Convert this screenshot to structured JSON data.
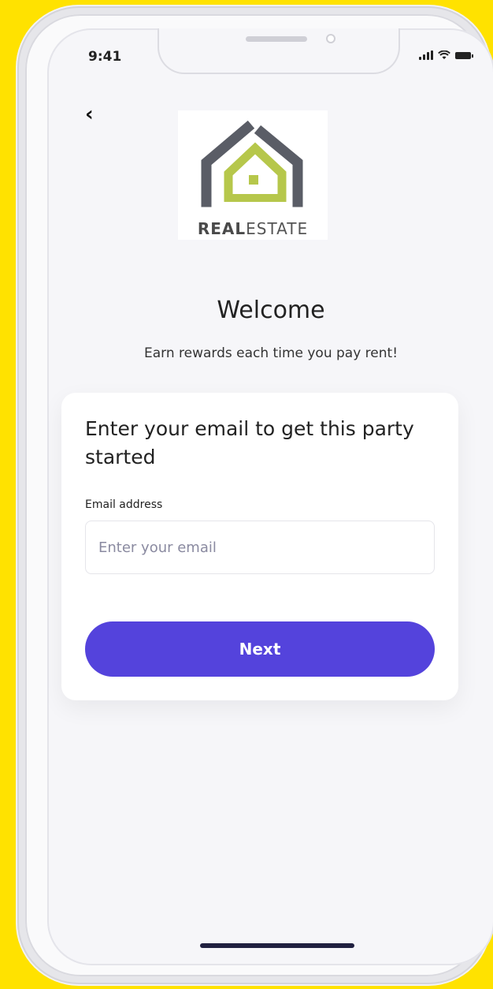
{
  "status_bar": {
    "time": "9:41"
  },
  "logo": {
    "text_bold": "REAL",
    "text_regular": "ESTATE",
    "green": "#B6C74B",
    "gray": "#5A5D66"
  },
  "welcome": {
    "title": "Welcome",
    "subtitle": "Earn rewards each time you pay rent!"
  },
  "form": {
    "heading": "Enter your email to get this party started",
    "email_label": "Email address",
    "email_placeholder": "Enter your email",
    "email_value": "",
    "next_label": "Next"
  },
  "colors": {
    "background": "#FFE200",
    "primary": "#5443DC"
  }
}
